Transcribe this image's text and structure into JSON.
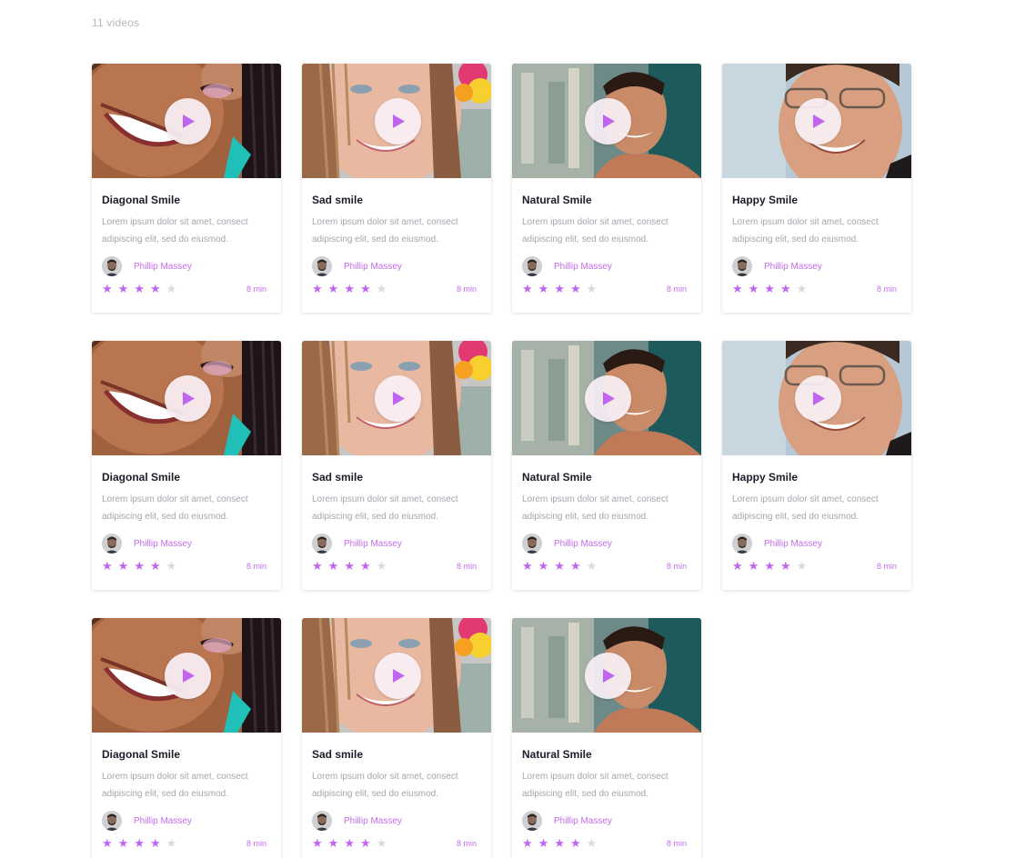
{
  "header": {
    "count_label": "11 videos"
  },
  "colors": {
    "accent": "#c065f0",
    "star_off": "#dadadd"
  },
  "videos": [
    {
      "title": "Diagonal Smile",
      "description": "Lorem ipsum dolor sit amet, consect adipiscing elit, sed do eiusmod.",
      "author": "Phillip Massey",
      "rating": 4,
      "max_rating": 5,
      "duration": "8 min",
      "thumbnail": "diagonal"
    },
    {
      "title": "Sad smile",
      "description": "Lorem ipsum dolor sit amet, consect adipiscing elit, sed do eiusmod.",
      "author": "Phillip Massey",
      "rating": 4,
      "max_rating": 5,
      "duration": "8 min",
      "thumbnail": "sad"
    },
    {
      "title": "Natural Smile",
      "description": "Lorem ipsum dolor sit amet, consect adipiscing elit, sed do eiusmod.",
      "author": "Phillip Massey",
      "rating": 4,
      "max_rating": 5,
      "duration": "8 min",
      "thumbnail": "natural"
    },
    {
      "title": "Happy Smile",
      "description": "Lorem ipsum dolor sit amet, consect adipiscing elit, sed do eiusmod.",
      "author": "Phillip Massey",
      "rating": 4,
      "max_rating": 5,
      "duration": "8 min",
      "thumbnail": "happy"
    },
    {
      "title": "Diagonal Smile",
      "description": "Lorem ipsum dolor sit amet, consect adipiscing elit, sed do eiusmod.",
      "author": "Phillip Massey",
      "rating": 4,
      "max_rating": 5,
      "duration": "8 min",
      "thumbnail": "diagonal"
    },
    {
      "title": "Sad smile",
      "description": "Lorem ipsum dolor sit amet, consect adipiscing elit, sed do eiusmod.",
      "author": "Phillip Massey",
      "rating": 4,
      "max_rating": 5,
      "duration": "8 min",
      "thumbnail": "sad"
    },
    {
      "title": "Natural Smile",
      "description": "Lorem ipsum dolor sit amet, consect adipiscing elit, sed do eiusmod.",
      "author": "Phillip Massey",
      "rating": 4,
      "max_rating": 5,
      "duration": "8 min",
      "thumbnail": "natural"
    },
    {
      "title": "Happy Smile",
      "description": "Lorem ipsum dolor sit amet, consect adipiscing elit, sed do eiusmod.",
      "author": "Phillip Massey",
      "rating": 4,
      "max_rating": 5,
      "duration": "8 min",
      "thumbnail": "happy"
    },
    {
      "title": "Diagonal Smile",
      "description": "Lorem ipsum dolor sit amet, consect adipiscing elit, sed do eiusmod.",
      "author": "Phillip Massey",
      "rating": 4,
      "max_rating": 5,
      "duration": "8 min",
      "thumbnail": "diagonal"
    },
    {
      "title": "Sad smile",
      "description": "Lorem ipsum dolor sit amet, consect adipiscing elit, sed do eiusmod.",
      "author": "Phillip Massey",
      "rating": 4,
      "max_rating": 5,
      "duration": "8 min",
      "thumbnail": "sad"
    },
    {
      "title": "Natural Smile",
      "description": "Lorem ipsum dolor sit amet, consect adipiscing elit, sed do eiusmod.",
      "author": "Phillip Massey",
      "rating": 4,
      "max_rating": 5,
      "duration": "8 min",
      "thumbnail": "natural"
    }
  ]
}
